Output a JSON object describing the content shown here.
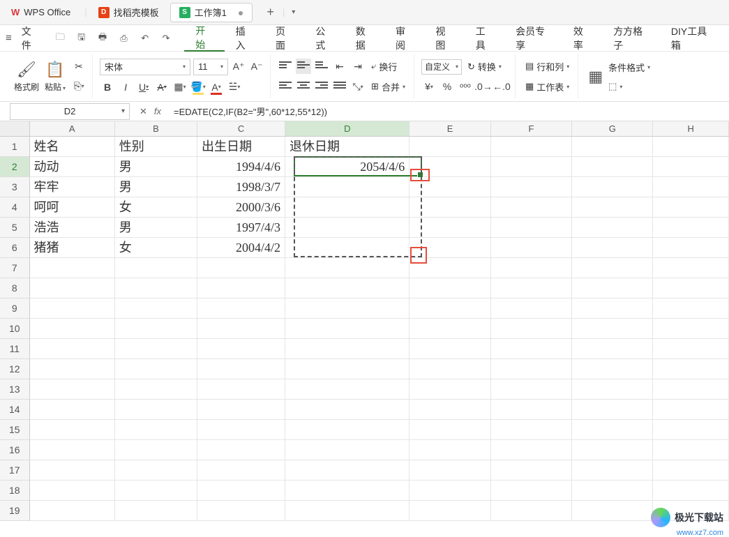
{
  "tabs": {
    "app": "WPS Office",
    "template": "找稻壳模板",
    "doc": "工作簿1",
    "add": "+"
  },
  "menu": {
    "file": "文件",
    "items": [
      "开始",
      "插入",
      "页面",
      "公式",
      "数据",
      "审阅",
      "视图",
      "工具",
      "会员专享",
      "效率",
      "方方格子",
      "DIY工具箱"
    ]
  },
  "ribbon": {
    "format_brush": "格式刷",
    "paste": "粘贴",
    "font_name": "宋体",
    "font_size": "11",
    "wrap": "换行",
    "merge": "合并",
    "numfmt": "自定义",
    "convert": "转换",
    "rowcol": "行和列",
    "sheet": "工作表",
    "cond_format": "条件格式"
  },
  "namebox": "D2",
  "formula": "=EDATE(C2,IF(B2=\"男\",60*12,55*12))",
  "columns": [
    "A",
    "B",
    "C",
    "D",
    "E",
    "F",
    "G",
    "H"
  ],
  "rows_shown": 19,
  "headers": {
    "A": "姓名",
    "B": "性别",
    "C": "出生日期",
    "D": "退休日期"
  },
  "data": [
    {
      "A": "动动",
      "B": "男",
      "C": "1994/4/6",
      "D": "2054/4/6"
    },
    {
      "A": "牢牢",
      "B": "男",
      "C": "1998/3/7",
      "D": ""
    },
    {
      "A": "呵呵",
      "B": "女",
      "C": "2000/3/6",
      "D": ""
    },
    {
      "A": "浩浩",
      "B": "男",
      "C": "1997/4/3",
      "D": ""
    },
    {
      "A": "猪猪",
      "B": "女",
      "C": "2004/4/2",
      "D": ""
    }
  ],
  "watermark": {
    "text": "极光下载站",
    "url": "www.xz7.com"
  },
  "chart_data": null
}
